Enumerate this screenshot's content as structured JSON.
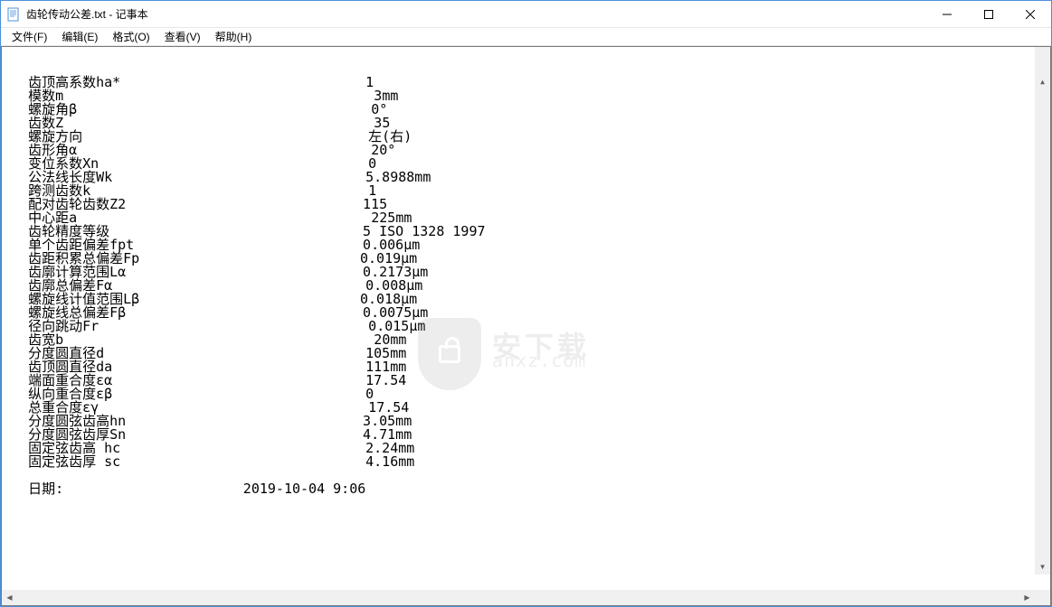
{
  "window": {
    "title": "齿轮传动公差.txt - 记事本",
    "min": "—",
    "max": "☐",
    "close": "✕"
  },
  "menu": {
    "file": "文件(F)",
    "edit": "编辑(E)",
    "format": "格式(O)",
    "view": "查看(V)",
    "help": "帮助(H)"
  },
  "rows": [
    {
      "label": "   齿顶高系数ha*",
      "value": "1"
    },
    {
      "label": "   模数m",
      "value": "3mm"
    },
    {
      "label": "   螺旋角β",
      "value": "0°"
    },
    {
      "label": "   齿数Z",
      "value": "35"
    },
    {
      "label": "   螺旋方向",
      "value": "左(右)"
    },
    {
      "label": "   齿形角α",
      "value": "20°"
    },
    {
      "label": "   变位系数Xn",
      "value": "0"
    },
    {
      "label": "   公法线长度Wk",
      "value": "5.8988mm"
    },
    {
      "label": "   跨测齿数k",
      "value": "1"
    },
    {
      "label": "   配对齿轮齿数Z2",
      "value": "115"
    },
    {
      "label": "   中心距a",
      "value": "225mm"
    },
    {
      "label": "   齿轮精度等级",
      "value": "5 ISO 1328 1997"
    },
    {
      "label": "   单个齿距偏差fpt",
      "value": "0.006μm"
    },
    {
      "label": "   齿距积累总偏差Fp",
      "value": "0.019μm"
    },
    {
      "label": "   齿廓计算范围Lα",
      "value": "0.2173μm"
    },
    {
      "label": "   齿廓总偏差Fα",
      "value": "0.008μm"
    },
    {
      "label": "   螺旋线计值范围Lβ",
      "value": "0.018μm"
    },
    {
      "label": "   螺旋线总偏差Fβ",
      "value": "0.0075μm"
    },
    {
      "label": "   径向跳动Fr",
      "value": "0.015μm"
    },
    {
      "label": "   齿宽b",
      "value": "20mm"
    },
    {
      "label": "   分度圆直径d",
      "value": "105mm"
    },
    {
      "label": "   齿顶圆直径da",
      "value": "111mm"
    },
    {
      "label": "   端面重合度εα",
      "value": "17.54"
    },
    {
      "label": "   纵向重合度εβ",
      "value": "0"
    },
    {
      "label": "   总重合度εγ",
      "value": "17.54"
    },
    {
      "label": "   分度圆弦齿高hn",
      "value": "3.05mm"
    },
    {
      "label": "   分度圆弦齿厚Sn",
      "value": "4.71mm"
    },
    {
      "label": "   固定弦齿高 hc",
      "value": "2.24mm"
    },
    {
      "label": "   固定弦齿厚 sc",
      "value": "4.16mm"
    }
  ],
  "date": {
    "label": "   日期:",
    "value": "2019-10-04 9:06"
  },
  "watermark": {
    "cn": "安下载",
    "en": "anxz.com"
  },
  "scroll": {
    "up": "▲",
    "down": "▼",
    "left": "◀",
    "right": "▶"
  },
  "value_column": 46
}
